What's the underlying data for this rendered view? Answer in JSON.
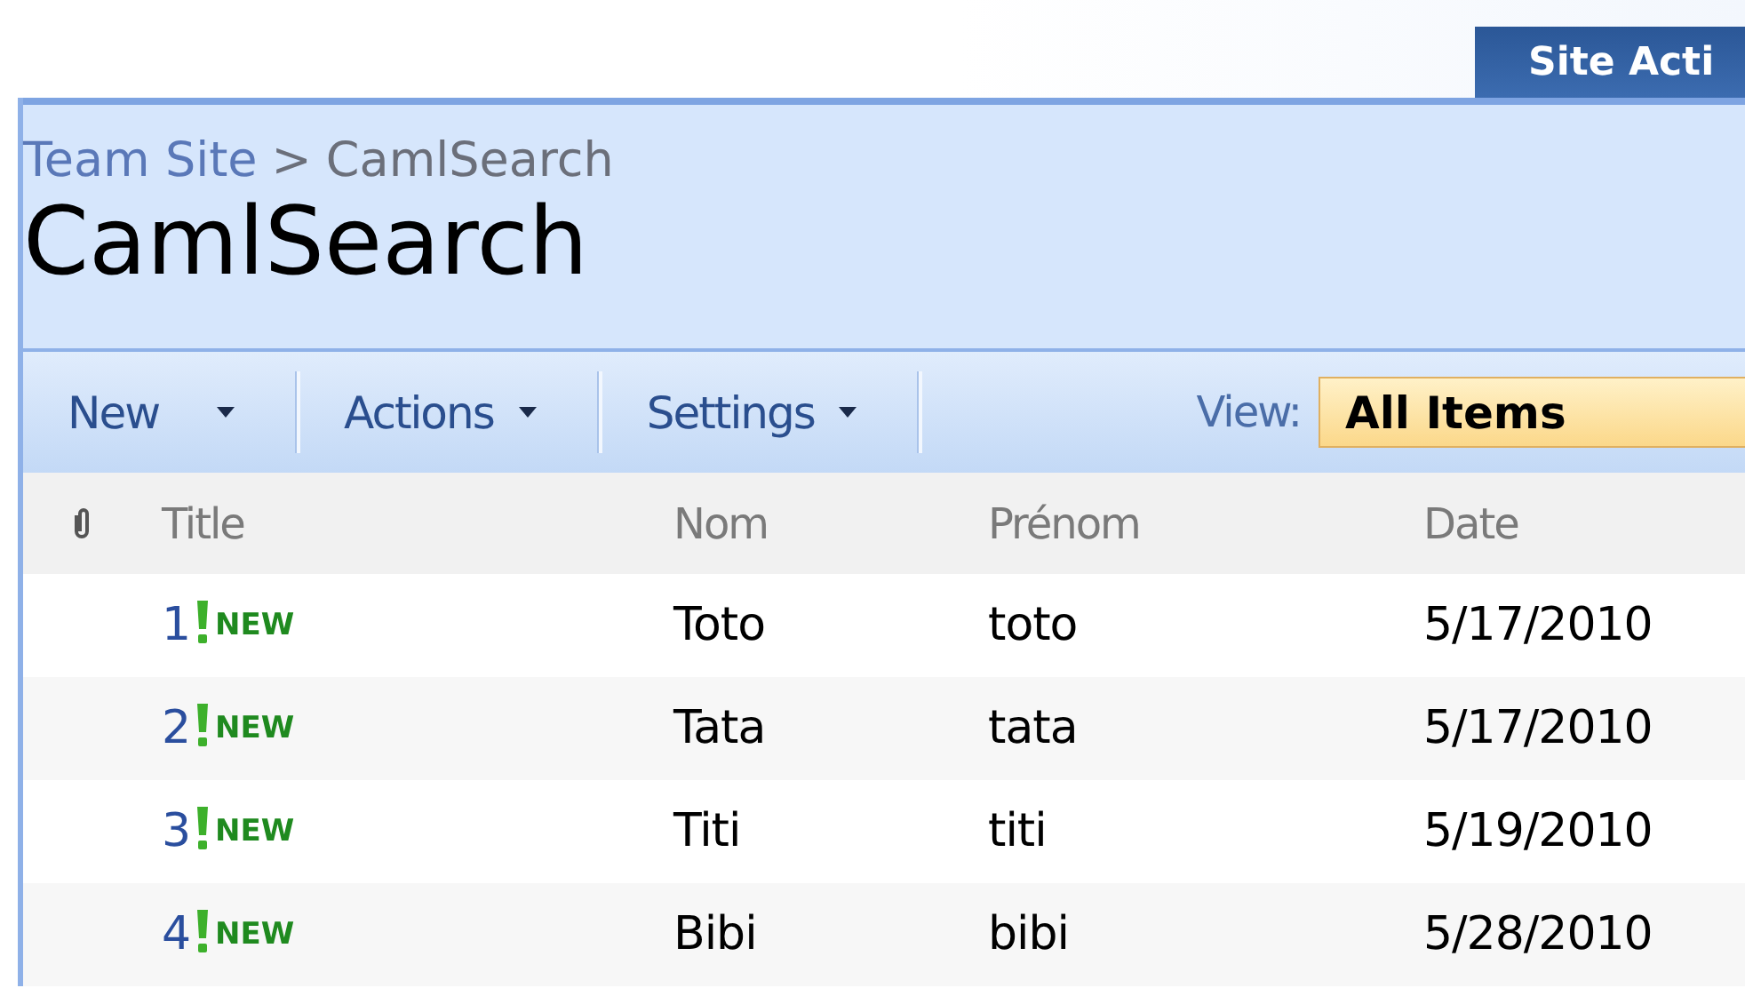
{
  "site_actions": {
    "label": "Site Acti"
  },
  "breadcrumb": [
    {
      "label": "Team Site"
    },
    {
      "label": ">"
    },
    {
      "label": "CamlSearch"
    }
  ],
  "page_title": "CamlSearch",
  "toolbar": {
    "menus": [
      {
        "label": "New"
      },
      {
        "label": "Actions"
      },
      {
        "label": "Settings"
      }
    ],
    "view_label": "View:",
    "view_value": "All Items"
  },
  "table": {
    "columns": [
      {
        "kind": "attachment"
      },
      {
        "kind": "text",
        "label": "Title"
      },
      {
        "kind": "text",
        "label": "Nom"
      },
      {
        "kind": "text",
        "label": "Prénom"
      },
      {
        "kind": "text",
        "label": "Date"
      }
    ],
    "rows": [
      {
        "title": "1",
        "is_new": true,
        "new_label": "NEW",
        "nom": "Toto",
        "prenom": "toto",
        "date": "5/17/2010"
      },
      {
        "title": "2",
        "is_new": true,
        "new_label": "NEW",
        "nom": "Tata",
        "prenom": "tata",
        "date": "5/17/2010"
      },
      {
        "title": "3",
        "is_new": true,
        "new_label": "NEW",
        "nom": "Titi",
        "prenom": "titi",
        "date": "5/19/2010"
      },
      {
        "title": "4",
        "is_new": true,
        "new_label": "NEW",
        "nom": "Bibi",
        "prenom": "bibi",
        "date": "5/28/2010"
      }
    ]
  }
}
